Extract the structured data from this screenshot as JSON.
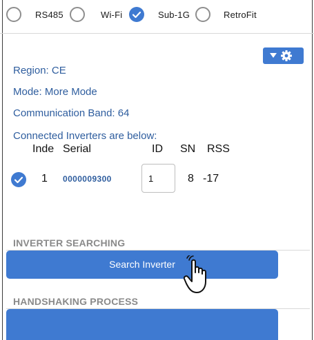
{
  "protocol_options": [
    {
      "label": "RS485",
      "selected": false
    },
    {
      "label": "Wi-Fi",
      "selected": false
    },
    {
      "label": "Sub-1G",
      "selected": true
    },
    {
      "label": "RetroFit",
      "selected": false
    }
  ],
  "settings_button": {
    "icons": [
      "chevron-down-icon",
      "gear-icon"
    ]
  },
  "info": {
    "region_label": "Region:",
    "region_value": "CE",
    "mode_label": "Mode:",
    "mode_value": "More Mode",
    "band_label": "Communication Band:",
    "band_value": "64",
    "connected_text": "Connected Inverters are below:"
  },
  "table": {
    "headers": {
      "index": "Inde",
      "serial": "Serial",
      "id": "ID",
      "sn": "SN",
      "rss": "RSS"
    },
    "rows": [
      {
        "checked": true,
        "index": "1",
        "serial": "0000009300",
        "id": "1",
        "sn": "8",
        "rss": "-17"
      }
    ]
  },
  "sections": {
    "searching_title": "INVERTER SEARCHING",
    "search_button": "Search Inverter",
    "handshaking_title": "HANDSHAKING PROCESS",
    "handshaking_button": ""
  },
  "colors": {
    "accent": "#3f7ad1",
    "info_text": "#2e5d9e",
    "section_title": "#8a8a8a"
  }
}
